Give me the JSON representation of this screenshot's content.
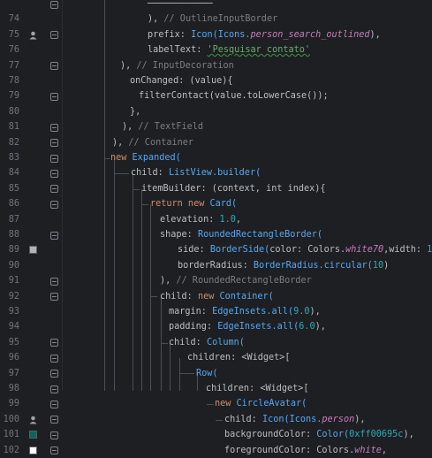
{
  "editor": {
    "lines": [
      {
        "num": "",
        "indent": 167,
        "tokens": [
          {
            "t": "────────────",
            "c": "p"
          }
        ]
      },
      {
        "num": "74",
        "indent": 167,
        "tokens": [
          {
            "t": "), ",
            "c": "p"
          },
          {
            "t": "// OutlineInputBorder",
            "c": "c"
          }
        ]
      },
      {
        "num": "75",
        "indent": 167,
        "tokens": [
          {
            "t": "prefix: ",
            "c": "prop"
          },
          {
            "t": "Icon(Icons.",
            "c": "fn"
          },
          {
            "t": "person_search_outlined",
            "c": "i"
          },
          {
            "t": "),",
            "c": "p"
          }
        ]
      },
      {
        "num": "76",
        "indent": 167,
        "tokens": [
          {
            "t": "labelText: ",
            "c": "prop"
          },
          {
            "t": "'Pesquisar contato'",
            "c": "s"
          }
        ]
      },
      {
        "num": "77",
        "indent": 136,
        "tokens": [
          {
            "t": "), ",
            "c": "p"
          },
          {
            "t": "// InputDecoration",
            "c": "c"
          }
        ]
      },
      {
        "num": "78",
        "indent": 147,
        "tokens": [
          {
            "t": "onChanged: (value){",
            "c": "prop"
          }
        ]
      },
      {
        "num": "79",
        "indent": 157,
        "tokens": [
          {
            "t": "filterContact(value.toLowerCase());",
            "c": "p"
          }
        ]
      },
      {
        "num": "80",
        "indent": 147,
        "tokens": [
          {
            "t": "},",
            "c": "p"
          }
        ]
      },
      {
        "num": "81",
        "indent": 138,
        "tokens": [
          {
            "t": "), ",
            "c": "p"
          },
          {
            "t": "// TextField",
            "c": "c"
          }
        ]
      },
      {
        "num": "82",
        "indent": 127,
        "tokens": [
          {
            "t": "), ",
            "c": "p"
          },
          {
            "t": "// Container",
            "c": "c"
          }
        ]
      },
      {
        "num": "83",
        "indent": 125,
        "tokens": [
          {
            "t": "new ",
            "c": "k"
          },
          {
            "t": "Expanded(",
            "c": "fn"
          }
        ]
      },
      {
        "num": "84",
        "indent": 148,
        "tokens": [
          {
            "t": "child: ",
            "c": "prop"
          },
          {
            "t": "ListView.builder(",
            "c": "fn"
          }
        ]
      },
      {
        "num": "85",
        "indent": 160,
        "tokens": [
          {
            "t": "itemBuilder: (context, int index){",
            "c": "prop"
          }
        ]
      },
      {
        "num": "86",
        "indent": 170,
        "tokens": [
          {
            "t": "return new ",
            "c": "k"
          },
          {
            "t": "Card(",
            "c": "fn"
          }
        ]
      },
      {
        "num": "87",
        "indent": 181,
        "tokens": [
          {
            "t": "elevation: ",
            "c": "prop"
          },
          {
            "t": "1.0",
            "c": "n"
          },
          {
            "t": ",",
            "c": "p"
          }
        ]
      },
      {
        "num": "88",
        "indent": 181,
        "tokens": [
          {
            "t": "shape: ",
            "c": "prop"
          },
          {
            "t": "RoundedRectangleBorder(",
            "c": "fn"
          }
        ]
      },
      {
        "num": "89",
        "indent": 201,
        "tokens": [
          {
            "t": "side: ",
            "c": "prop"
          },
          {
            "t": "BorderSide(",
            "c": "fn"
          },
          {
            "t": "color: Colors.",
            "c": "prop"
          },
          {
            "t": "white70",
            "c": "i"
          },
          {
            "t": ",width: ",
            "c": "prop"
          },
          {
            "t": "1",
            "c": "n"
          },
          {
            "t": "),",
            "c": "p"
          }
        ]
      },
      {
        "num": "90",
        "indent": 201,
        "tokens": [
          {
            "t": "borderRadius: ",
            "c": "prop"
          },
          {
            "t": "BorderRadius.circular(",
            "c": "fn"
          },
          {
            "t": "10",
            "c": "n"
          },
          {
            "t": ")",
            "c": "p"
          }
        ]
      },
      {
        "num": "91",
        "indent": 181,
        "tokens": [
          {
            "t": "), ",
            "c": "p"
          },
          {
            "t": "// RoundedRectangleBorder",
            "c": "c"
          }
        ]
      },
      {
        "num": "92",
        "indent": 181,
        "tokens": [
          {
            "t": "child: ",
            "c": "prop"
          },
          {
            "t": "new ",
            "c": "k"
          },
          {
            "t": "Container(",
            "c": "fn"
          }
        ]
      },
      {
        "num": "93",
        "indent": 191,
        "tokens": [
          {
            "t": "margin: ",
            "c": "prop"
          },
          {
            "t": "EdgeInsets.all(",
            "c": "fn"
          },
          {
            "t": "9.0",
            "c": "n"
          },
          {
            "t": "),",
            "c": "p"
          }
        ]
      },
      {
        "num": "94",
        "indent": 191,
        "tokens": [
          {
            "t": "padding: ",
            "c": "prop"
          },
          {
            "t": "EdgeInsets.all(",
            "c": "fn"
          },
          {
            "t": "6.0",
            "c": "n"
          },
          {
            "t": "),",
            "c": "p"
          }
        ]
      },
      {
        "num": "95",
        "indent": 191,
        "tokens": [
          {
            "t": "child: ",
            "c": "prop"
          },
          {
            "t": "Column(",
            "c": "fn"
          }
        ]
      },
      {
        "num": "96",
        "indent": 212,
        "tokens": [
          {
            "t": "children: <Widget>[",
            "c": "prop"
          }
        ]
      },
      {
        "num": "97",
        "indent": 222,
        "tokens": [
          {
            "t": "Row(",
            "c": "fn"
          }
        ]
      },
      {
        "num": "98",
        "indent": 233,
        "tokens": [
          {
            "t": "children: <Widget>[",
            "c": "prop"
          }
        ]
      },
      {
        "num": "99",
        "indent": 243,
        "tokens": [
          {
            "t": "new ",
            "c": "k"
          },
          {
            "t": "CircleAvatar(",
            "c": "fn"
          }
        ]
      },
      {
        "num": "100",
        "indent": 254,
        "tokens": [
          {
            "t": "child: ",
            "c": "prop"
          },
          {
            "t": "Icon(Icons.",
            "c": "fn"
          },
          {
            "t": "person",
            "c": "i"
          },
          {
            "t": "),",
            "c": "p"
          }
        ]
      },
      {
        "num": "101",
        "indent": 254,
        "tokens": [
          {
            "t": "backgroundColor: ",
            "c": "prop"
          },
          {
            "t": "Color(",
            "c": "fn"
          },
          {
            "t": "0xff00695c",
            "c": "n"
          },
          {
            "t": "),",
            "c": "p"
          }
        ]
      },
      {
        "num": "102",
        "indent": 254,
        "tokens": [
          {
            "t": "foregroundColor: Colors.",
            "c": "prop"
          },
          {
            "t": "white",
            "c": "i"
          },
          {
            "t": ",",
            "c": "p"
          }
        ]
      }
    ]
  },
  "gutter_icons": [
    {
      "line": "75",
      "icon": "person-search-icon",
      "color": "#9da0a8"
    },
    {
      "line": "89",
      "icon": "color-swatch-icon",
      "color": "#b3b3b3"
    },
    {
      "line": "100",
      "icon": "person-icon",
      "color": "#9da0a8"
    },
    {
      "line": "101",
      "icon": "color-swatch-icon",
      "color": "#00695c"
    },
    {
      "line": "102",
      "icon": "color-swatch-icon",
      "color": "#ffffff"
    }
  ]
}
